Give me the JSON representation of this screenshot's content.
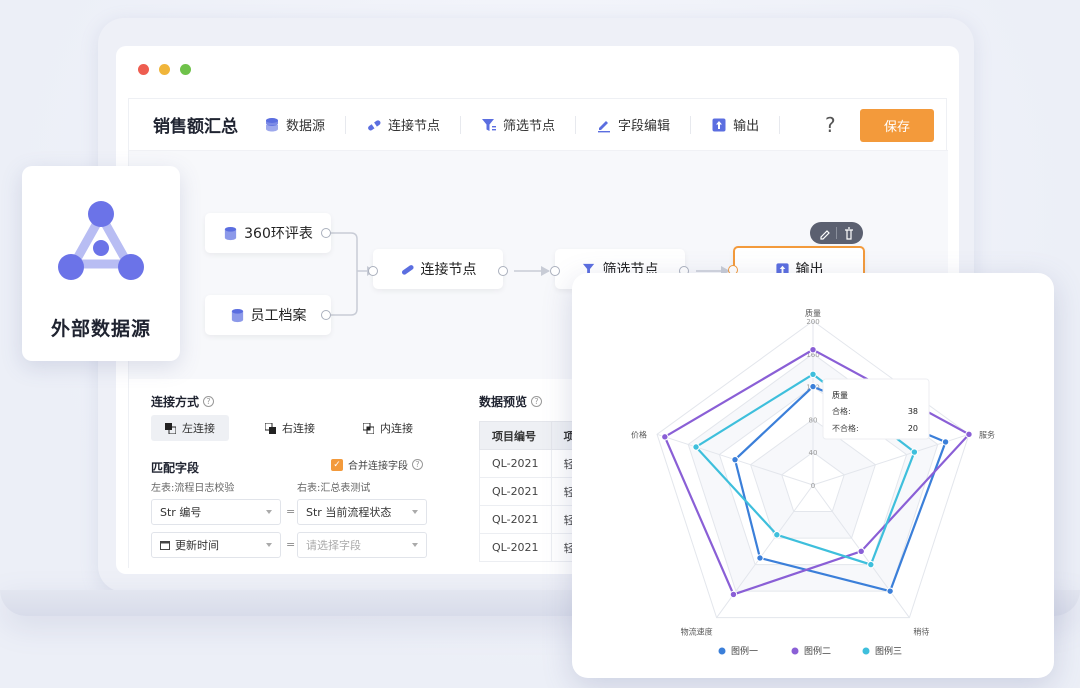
{
  "app": {
    "title": "销售额汇总",
    "save_label": "保存",
    "help_label": "?",
    "toolbar": [
      {
        "label": "数据源",
        "icon": "database-icon"
      },
      {
        "label": "连接节点",
        "icon": "link-icon"
      },
      {
        "label": "筛选节点",
        "icon": "filter-icon"
      },
      {
        "label": "字段编辑",
        "icon": "edit-icon"
      },
      {
        "label": "输出",
        "icon": "upload-icon"
      }
    ]
  },
  "flow": {
    "source1": "360环评表",
    "source2": "员工档案",
    "join": "连接节点",
    "filter": "筛选节点",
    "output": "输出"
  },
  "external": {
    "label": "外部数据源",
    "icon": "hub-icon"
  },
  "join_panel": {
    "title": "连接方式",
    "left_join": "左连接",
    "right_join": "右连接",
    "inner_join": "内连接",
    "match_title": "匹配字段",
    "merge_label": "合并连接字段",
    "left_table": "左表:流程日志校验",
    "right_table": "右表:汇总表测试",
    "row1_left": "Str 编号",
    "row1_right": "Str 当前流程状态",
    "row2_left": "更新时间",
    "row2_right_placeholder": "请选择字段",
    "equals": "="
  },
  "preview": {
    "title": "数据预览",
    "headers": [
      "项目编号",
      "项目"
    ],
    "rows": [
      [
        "QL-2021",
        "轻流"
      ],
      [
        "QL-2021",
        "轻流"
      ],
      [
        "QL-2021",
        "轻流"
      ],
      [
        "QL-2021",
        "轻流"
      ]
    ]
  },
  "colors": {
    "accent": "#f39a3b",
    "primary": "#6b73e8",
    "s1": "#3b7fd9",
    "s2": "#8a5fd6",
    "s3": "#3ebfdc"
  },
  "chart_data": {
    "type": "radar",
    "indicators": [
      "质量",
      "服务",
      "稍待",
      "物流速度",
      "价格"
    ],
    "max": 200,
    "ticks": [
      "0",
      "40",
      "80",
      "120",
      "160",
      "200"
    ],
    "series": [
      {
        "name": "图例一",
        "color": "#3b7fd9",
        "values": [
          120,
          170,
          160,
          110,
          100
        ]
      },
      {
        "name": "图例二",
        "color": "#8a5fd6",
        "values": [
          165,
          200,
          100,
          165,
          190
        ]
      },
      {
        "name": "图例三",
        "color": "#3ebfdc",
        "values": [
          135,
          130,
          120,
          75,
          150
        ]
      }
    ],
    "tooltip": {
      "title": "质量",
      "rows": [
        {
          "label": "合格:",
          "value": "38"
        },
        {
          "label": "不合格:",
          "value": "20"
        }
      ]
    }
  }
}
